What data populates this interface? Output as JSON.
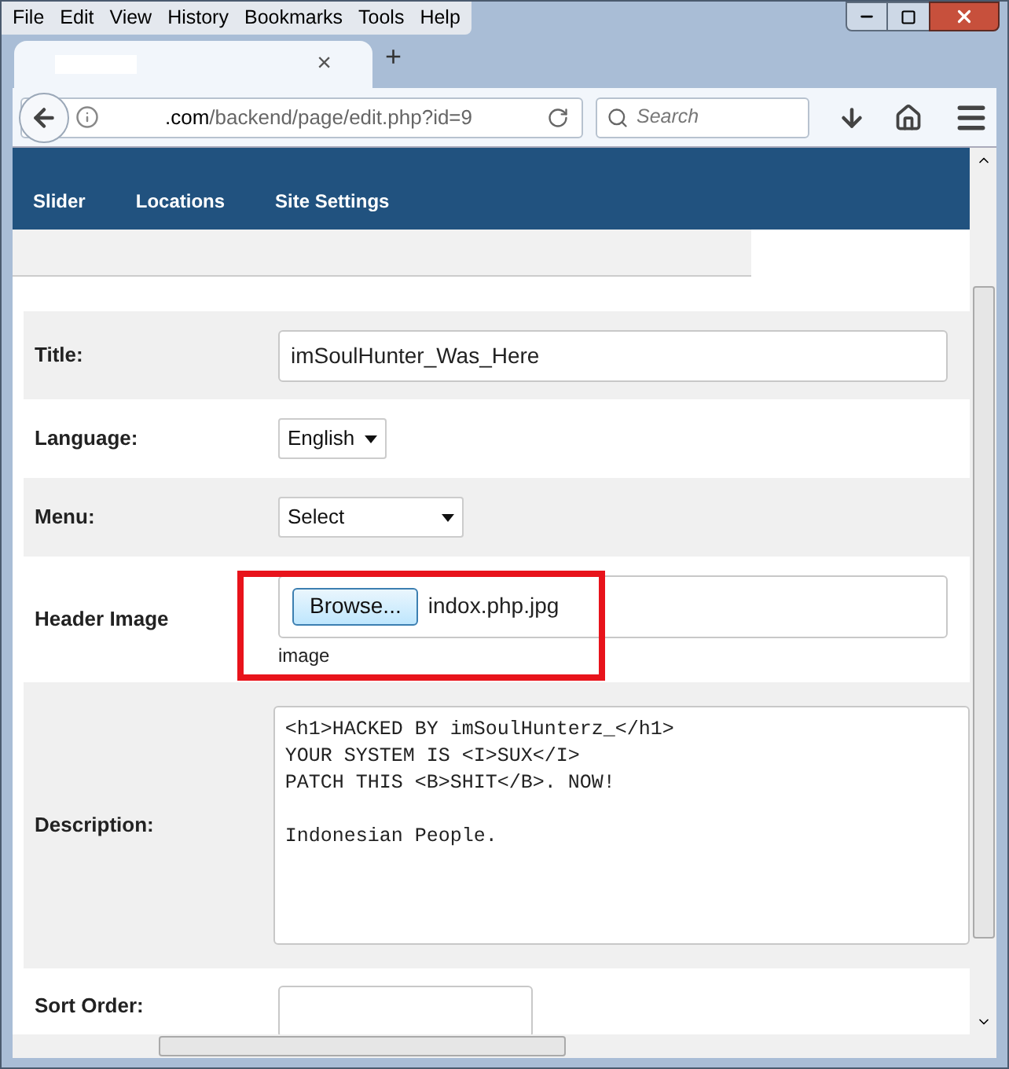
{
  "menu_bar": [
    "File",
    "Edit",
    "View",
    "History",
    "Bookmarks",
    "Tools",
    "Help"
  ],
  "tab": {
    "close": "×",
    "new_tab": "+"
  },
  "address_bar": {
    "url_host": ".com",
    "url_path": "/backend/page/edit.php?id=9"
  },
  "search": {
    "placeholder": "Search"
  },
  "site_nav": [
    "Slider",
    "Locations",
    "Site Settings"
  ],
  "form": [
    {
      "kind": "text",
      "label": "Title:",
      "value": "imSoulHunter_Was_Here"
    },
    {
      "kind": "select",
      "label": "Language:",
      "value": "English"
    },
    {
      "kind": "select",
      "label": "Menu:",
      "value": "Select"
    },
    {
      "kind": "file",
      "label": "Header Image",
      "button": "Browse...",
      "value": "indox.php.jpg",
      "hint": "image",
      "highlighted": true
    },
    {
      "kind": "textarea",
      "label": "Description:",
      "value": "<h1>HACKED BY imSoulHunterz_</h1>\nYOUR SYSTEM IS <I>SUX</I>\nPATCH THIS <B>SHIT</B>. NOW!\n\nIndonesian People."
    },
    {
      "kind": "text",
      "label": "Sort Order:"
    }
  ]
}
